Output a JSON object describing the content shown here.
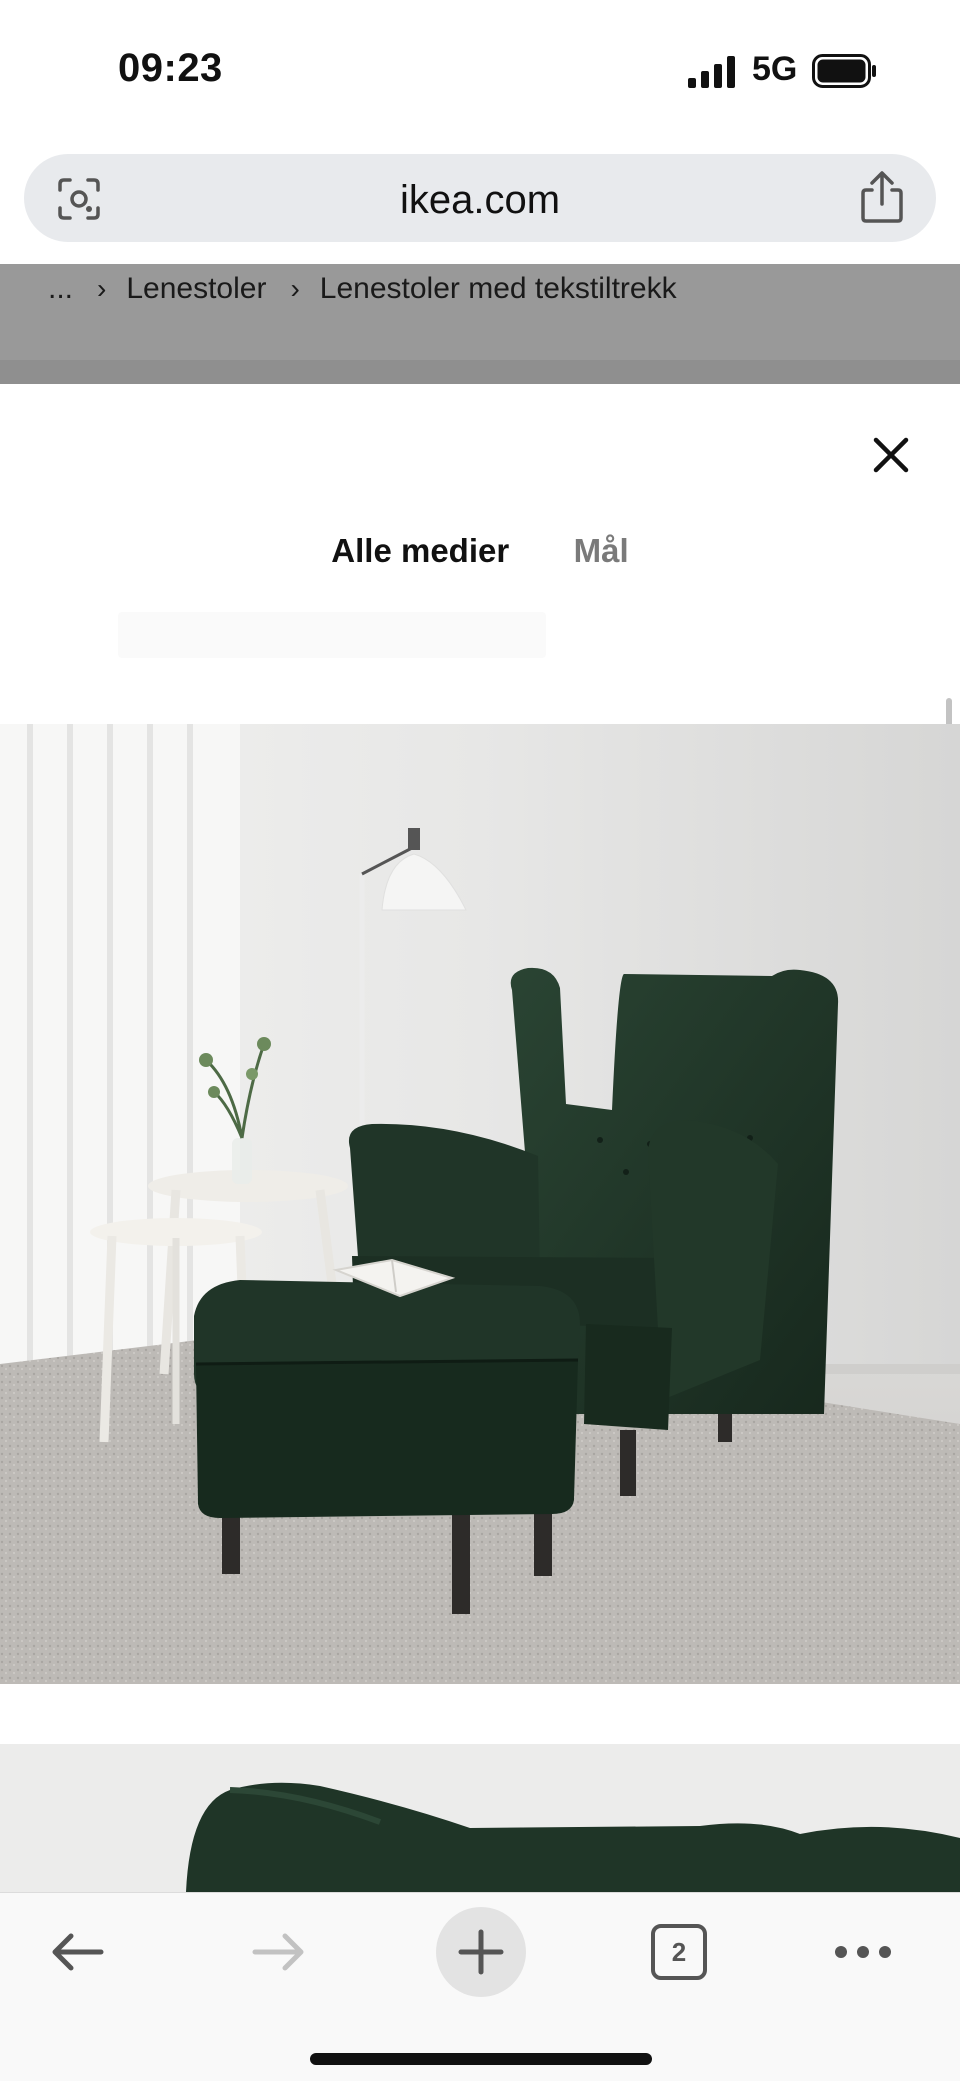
{
  "status_bar": {
    "time": "09:23",
    "network": "5G",
    "icons": [
      "cellular-signal-icon",
      "battery-icon"
    ]
  },
  "browser": {
    "url": "ikea.com",
    "icons": [
      "lens-search-icon",
      "share-icon"
    ]
  },
  "page": {
    "breadcrumb": [
      "...",
      "Lenestoler",
      "Lenestoler med tekstiltrekk"
    ]
  },
  "modal": {
    "close_icon": "close-icon",
    "tabs": [
      {
        "label": "Alle medier",
        "active": true
      },
      {
        "label": "Mål",
        "active": false
      }
    ],
    "media": [
      {
        "kind": "product-photo",
        "subject": "dark green wingback armchair with footstool"
      },
      {
        "kind": "product-photo",
        "subject": "armchair detail"
      }
    ]
  },
  "toolbar": {
    "open_tabs_count": "2",
    "icons": [
      "back-arrow-icon",
      "forward-arrow-icon",
      "new-tab-plus-icon",
      "tabs-icon",
      "more-icon"
    ]
  },
  "colors": {
    "upholstery": "#1f3327",
    "url_bar": "#e8eaed",
    "backdrop": "#999999"
  }
}
